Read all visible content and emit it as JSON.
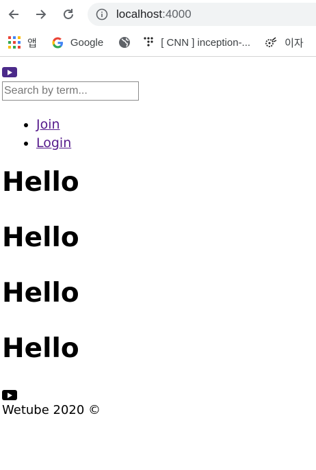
{
  "browser": {
    "url_host": "localhost",
    "url_port": ":4000",
    "bookmarks": [
      {
        "label": "앱",
        "icon": "apps-grid-icon"
      },
      {
        "label": "Google",
        "icon": "google-icon"
      },
      {
        "label": "",
        "icon": "globe-icon"
      },
      {
        "label": "[ CNN ] inception-...",
        "icon": "tensorflow-icon"
      },
      {
        "label": "이자",
        "icon": "gear-bug-icon"
      }
    ]
  },
  "header": {
    "search_placeholder": "Search by term...",
    "nav": [
      {
        "label": "Join"
      },
      {
        "label": "Login"
      }
    ]
  },
  "main": {
    "headings": [
      "Hello",
      "Hello",
      "Hello",
      "Hello"
    ]
  },
  "footer": {
    "text": "Wetube 2020 ©"
  },
  "colors": {
    "header_logo": "#4b2a8a",
    "footer_logo": "#000000",
    "link": "#551a8b"
  }
}
